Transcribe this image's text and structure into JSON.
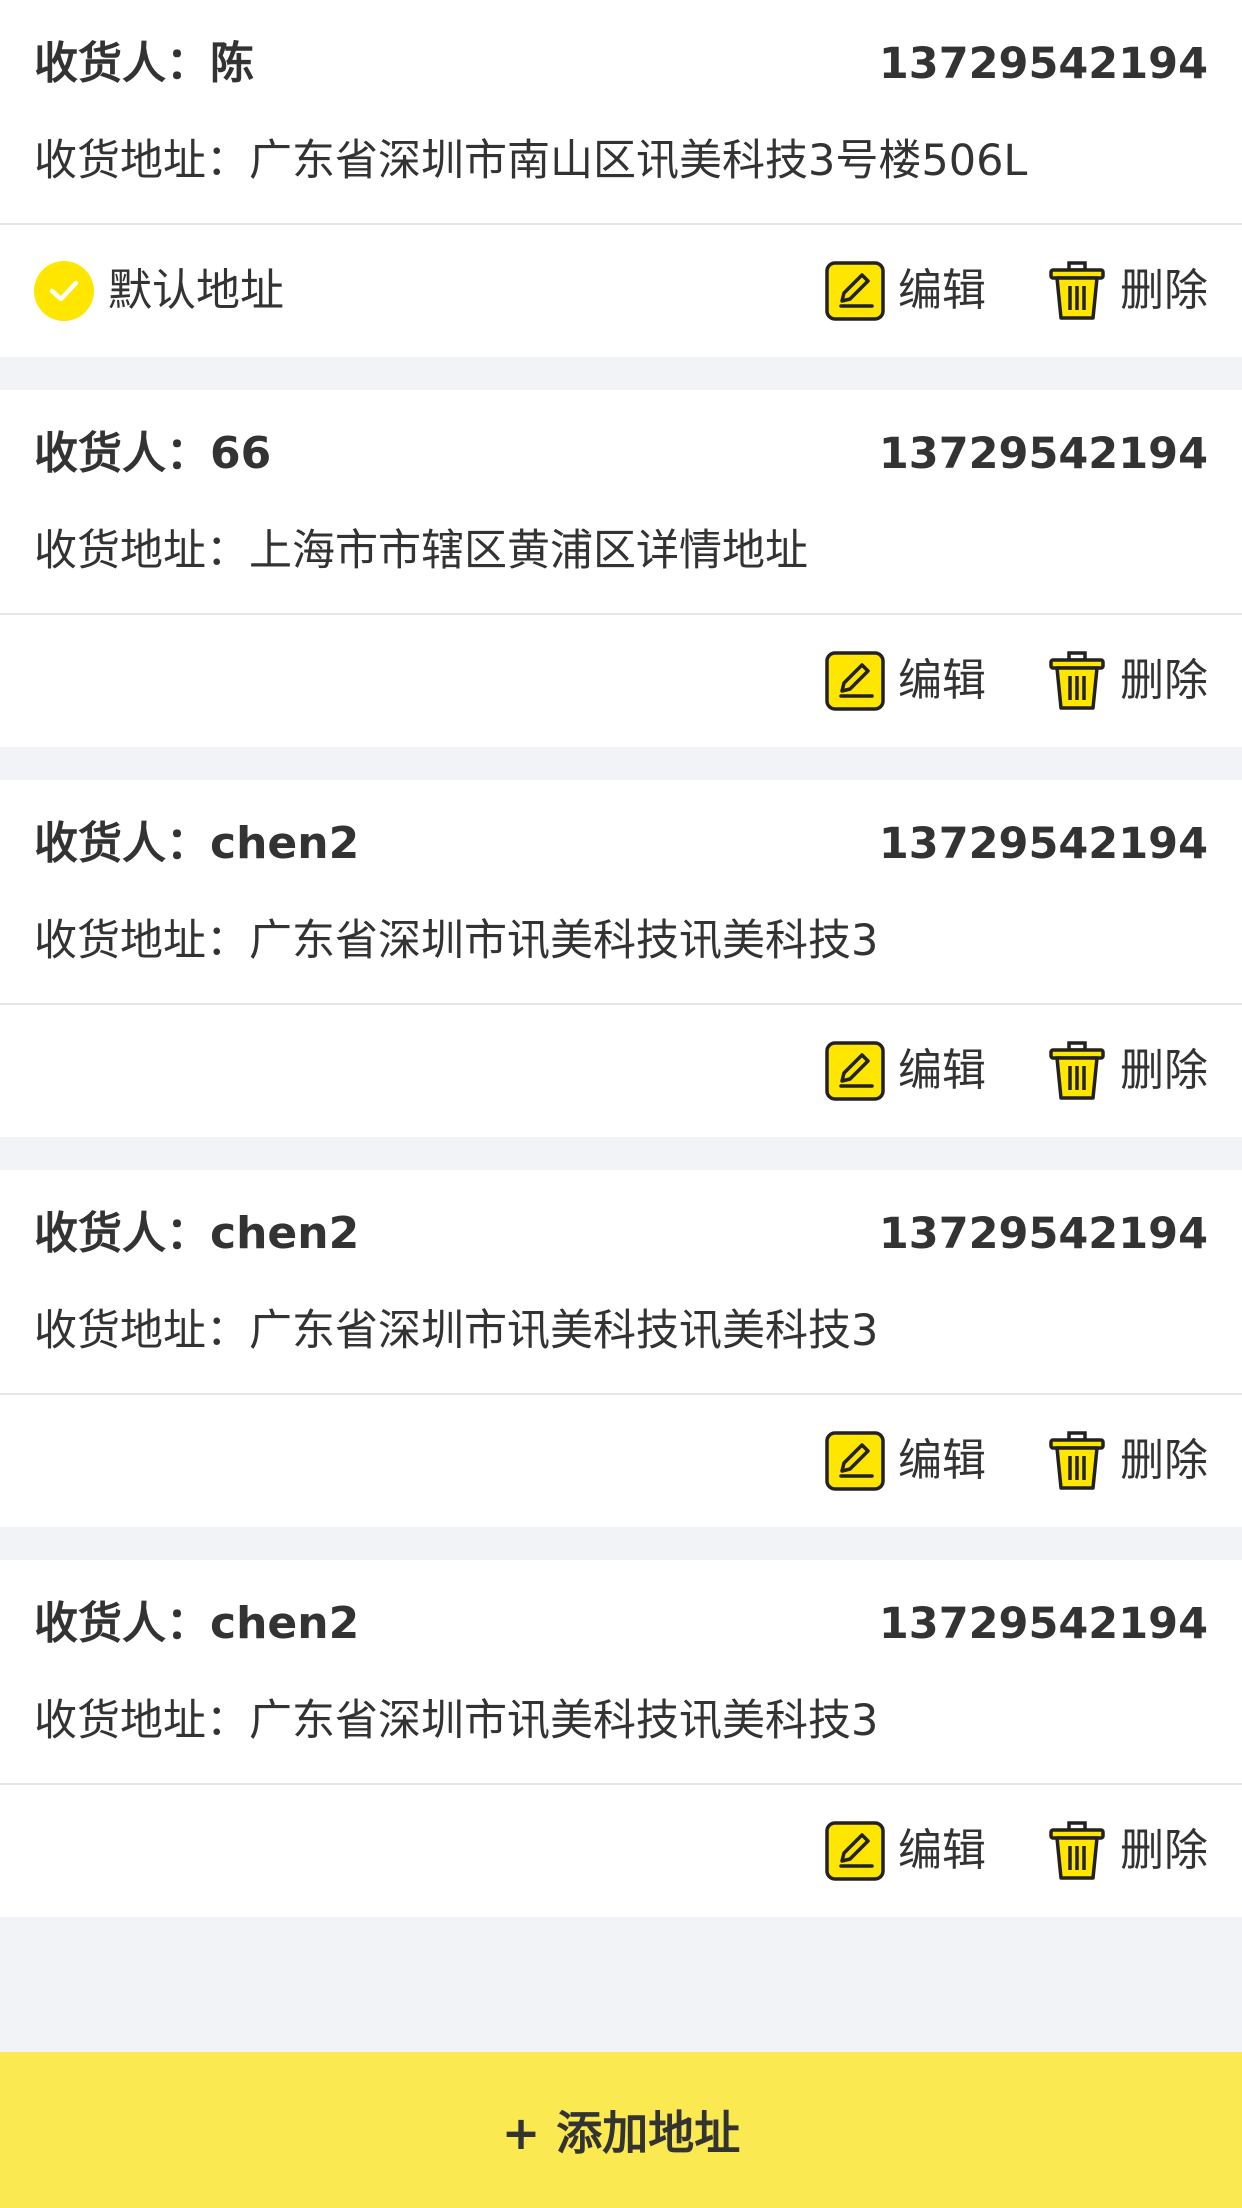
{
  "labels": {
    "consignee_prefix": "收货人：",
    "address_prefix": "收货地址：",
    "default_address": "默认地址",
    "edit": "编辑",
    "delete": "删除"
  },
  "addresses": [
    {
      "name": "陈",
      "phone": "13729542194",
      "address": "广东省深圳市南山区讯美科技3号楼506L",
      "is_default": true
    },
    {
      "name": "66",
      "phone": "13729542194",
      "address": "上海市市辖区黄浦区详情地址",
      "is_default": false
    },
    {
      "name": "chen2",
      "phone": "13729542194",
      "address": "广东省深圳市讯美科技讯美科技3",
      "is_default": false
    },
    {
      "name": "chen2",
      "phone": "13729542194",
      "address": "广东省深圳市讯美科技讯美科技3",
      "is_default": false
    },
    {
      "name": "chen2",
      "phone": "13729542194",
      "address": "广东省深圳市讯美科技讯美科技3",
      "is_default": false
    }
  ],
  "footer": {
    "add_address_label": "+ 添加地址"
  },
  "colors": {
    "accent": "#ffe600",
    "button_background": "#fbe951",
    "page_background": "#f1f3f6",
    "text": "#333333"
  },
  "icons": {
    "default_indicator": "check-circle-icon",
    "edit": "pencil-square-icon",
    "delete": "trash-can-icon"
  }
}
